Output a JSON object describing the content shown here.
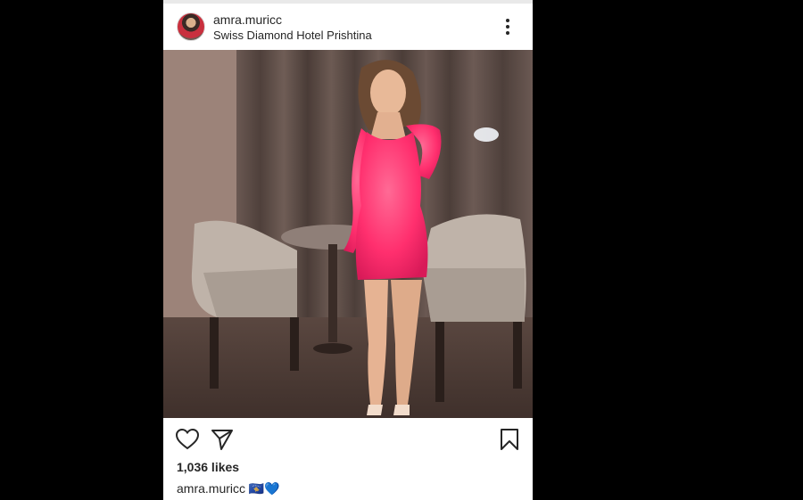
{
  "post": {
    "username": "amra.muricc",
    "location": "Swiss Diamond Hotel Prishtina",
    "likes": "1,036 likes",
    "caption_username": "amra.muricc",
    "caption_emoji": "🇽🇰💙"
  },
  "icons": {
    "avatar": "profile-avatar",
    "more": "more-options-icon",
    "like": "heart-icon",
    "share": "paper-plane-icon",
    "save": "bookmark-icon"
  },
  "colors": {
    "background": "#000000",
    "card": "#ffffff",
    "text": "#262626",
    "dress": "#ff2f6e"
  }
}
